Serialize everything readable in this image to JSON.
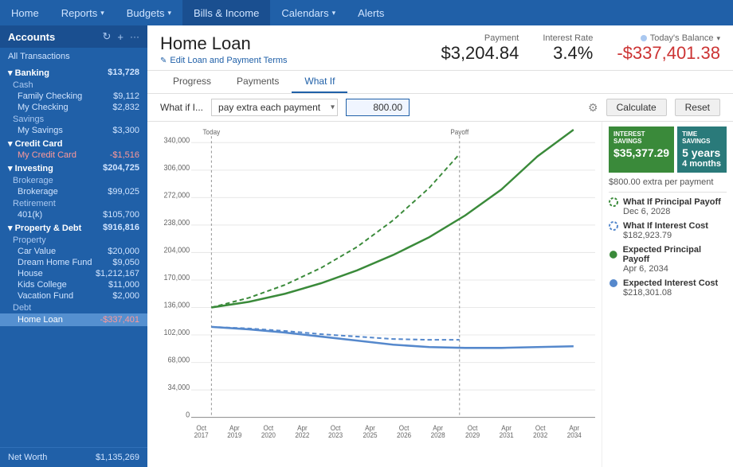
{
  "nav": {
    "items": [
      {
        "label": "Home",
        "active": false
      },
      {
        "label": "Reports",
        "dropdown": true,
        "active": false
      },
      {
        "label": "Budgets",
        "dropdown": true,
        "active": false
      },
      {
        "label": "Bills & Income",
        "active": false
      },
      {
        "label": "Calendars",
        "dropdown": true,
        "active": false
      },
      {
        "label": "Alerts",
        "active": false
      }
    ]
  },
  "sidebar": {
    "title": "Accounts",
    "all_transactions": "All Transactions",
    "groups": [
      {
        "label": "Banking",
        "total": "$13,728",
        "items": [
          {
            "label": "Cash",
            "value": "",
            "sub": true
          },
          {
            "label": "Family Checking",
            "value": "$9,112"
          },
          {
            "label": "My Checking",
            "value": "$2,832"
          },
          {
            "label": "Savings",
            "value": "",
            "sub": true
          },
          {
            "label": "My Savings",
            "value": "$3,300"
          }
        ]
      },
      {
        "label": "Credit Card",
        "total": "",
        "items": [
          {
            "label": "My Credit Card",
            "value": "-$1,516",
            "negative": true
          }
        ]
      },
      {
        "label": "Investing",
        "total": "$204,725",
        "items": [
          {
            "label": "Brokerage",
            "value": "",
            "sub": true
          },
          {
            "label": "Brokerage",
            "value": "$99,025"
          },
          {
            "label": "Retirement",
            "value": "",
            "sub": true
          },
          {
            "label": "401(k)",
            "value": "$105,700"
          }
        ]
      },
      {
        "label": "Property & Debt",
        "total": "$916,816",
        "items": [
          {
            "label": "Property",
            "value": "",
            "sub": true
          },
          {
            "label": "Car Value",
            "value": "$20,000"
          },
          {
            "label": "Dream Home Fund",
            "value": "$9,050"
          },
          {
            "label": "House",
            "value": "$1,212,167"
          },
          {
            "label": "Kids College",
            "value": "$11,000"
          },
          {
            "label": "Vacation Fund",
            "value": "$2,000"
          },
          {
            "label": "Debt",
            "value": "",
            "sub": true
          },
          {
            "label": "Home Loan",
            "value": "-$337,401",
            "negative": true,
            "selected": true
          }
        ]
      }
    ],
    "net_worth_label": "Net Worth",
    "net_worth_value": "$1,135,269"
  },
  "page": {
    "title": "Home Loan",
    "edit_label": "Edit Loan and Payment Terms",
    "payment_label": "Payment",
    "payment_value": "$3,204.84",
    "interest_label": "Interest Rate",
    "interest_value": "3.4%",
    "balance_label": "Today's Balance",
    "balance_value": "-$337,401.38"
  },
  "tabs": [
    {
      "label": "Progress",
      "active": false
    },
    {
      "label": "Payments",
      "active": false
    },
    {
      "label": "What If",
      "active": true
    }
  ],
  "whatif": {
    "label": "What if I...",
    "select_value": "pay extra each payment",
    "input_value": "800.00",
    "calculate_label": "Calculate",
    "reset_label": "Reset"
  },
  "legend": {
    "interest_savings_label": "INTEREST SAVINGS",
    "interest_savings_value": "$35,377.29",
    "time_savings_label": "TIME SAVINGS",
    "time_savings_value": "5 years",
    "time_savings_sub": "4 months",
    "extra_payment": "$800.00 extra per payment",
    "items": [
      {
        "type": "dashed-green",
        "title": "What If Principal Payoff",
        "value": "Dec 6, 2028"
      },
      {
        "type": "dashed-blue",
        "title": "What If Interest Cost",
        "value": "$182,923.79"
      },
      {
        "type": "solid-green",
        "title": "Expected Principal Payoff",
        "value": "Apr 6, 2034"
      },
      {
        "type": "solid-blue",
        "title": "Expected Interest Cost",
        "value": "$218,301.08"
      }
    ]
  },
  "chart": {
    "y_labels": [
      "340,000",
      "306,000",
      "272,000",
      "238,000",
      "204,000",
      "170,000",
      "136,000",
      "102,000",
      "68,000",
      "34,000",
      "0"
    ],
    "x_labels": [
      "Oct\n2017",
      "Apr\n2019",
      "Oct\n2020",
      "Apr\n2022",
      "Oct\n2023",
      "Apr\n2025",
      "Oct\n2026",
      "Apr\n2028",
      "Oct\n2029",
      "Apr\n2031",
      "Oct\n2032",
      "Apr\n2034"
    ],
    "today_label": "Today",
    "payoff_label": "Payoff"
  }
}
